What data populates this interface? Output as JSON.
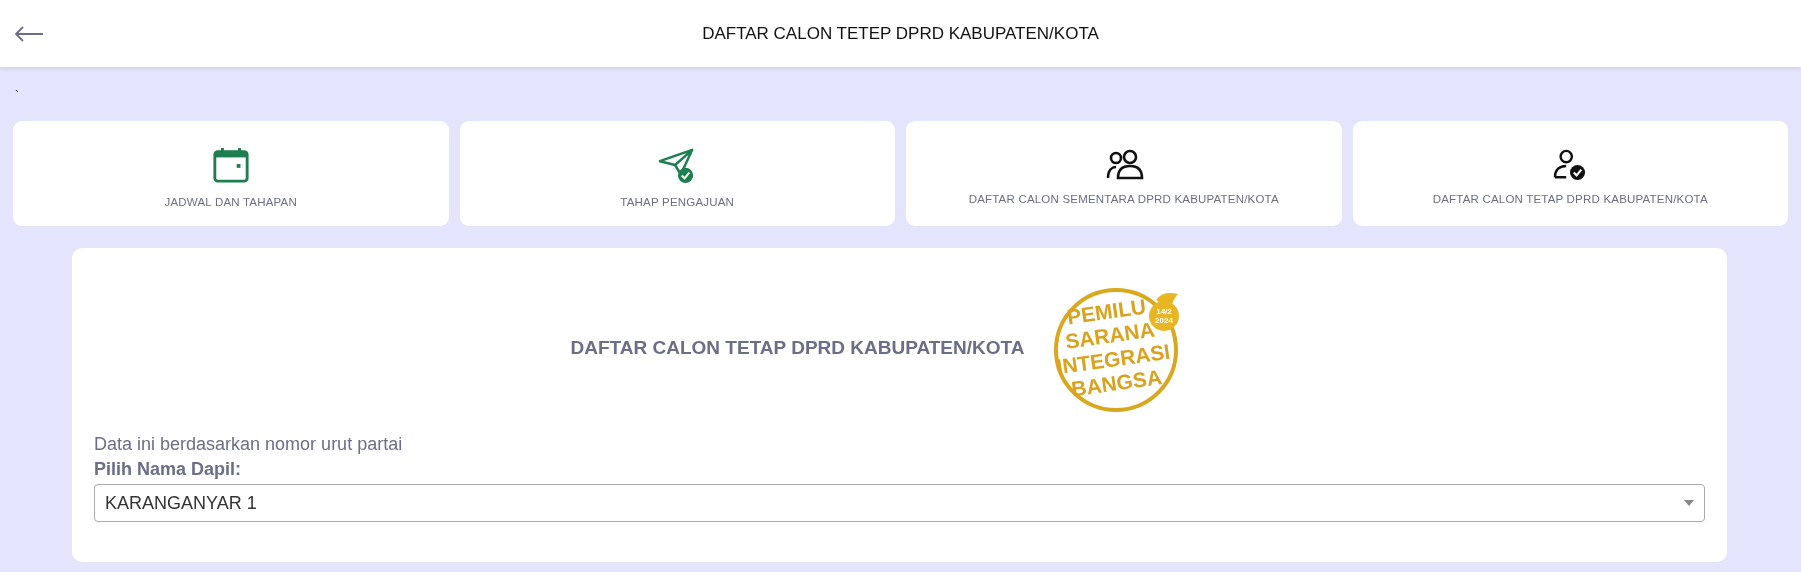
{
  "header": {
    "title": "DAFTAR CALON TETEP DPRD KABUPATEN/KOTA"
  },
  "note": "`",
  "menu_cards": [
    {
      "kind": "calendar",
      "label": "JADWAL DAN TAHAPAN"
    },
    {
      "kind": "send",
      "label": "TAHAP PENGAJUAN"
    },
    {
      "kind": "people",
      "label": "DAFTAR CALON SEMENTARA DPRD KABUPATEN/KOTA"
    },
    {
      "kind": "person-check",
      "label": "DAFTAR CALON TETAP DPRD KABUPATEN/KOTA"
    }
  ],
  "main": {
    "title": "DAFTAR CALON TETAP DPRD KABUPATEN/KOTA",
    "logo": {
      "lines": [
        "PEMILU",
        "SARANA",
        "INTEGRASI",
        "BANGSA"
      ],
      "date": [
        "14/2",
        "2024"
      ]
    },
    "info": "Data ini berdasarkan nomor urut partai",
    "dapil_label": "Pilih Nama Dapil:",
    "dapil_value": "KARANGANYAR 1"
  }
}
